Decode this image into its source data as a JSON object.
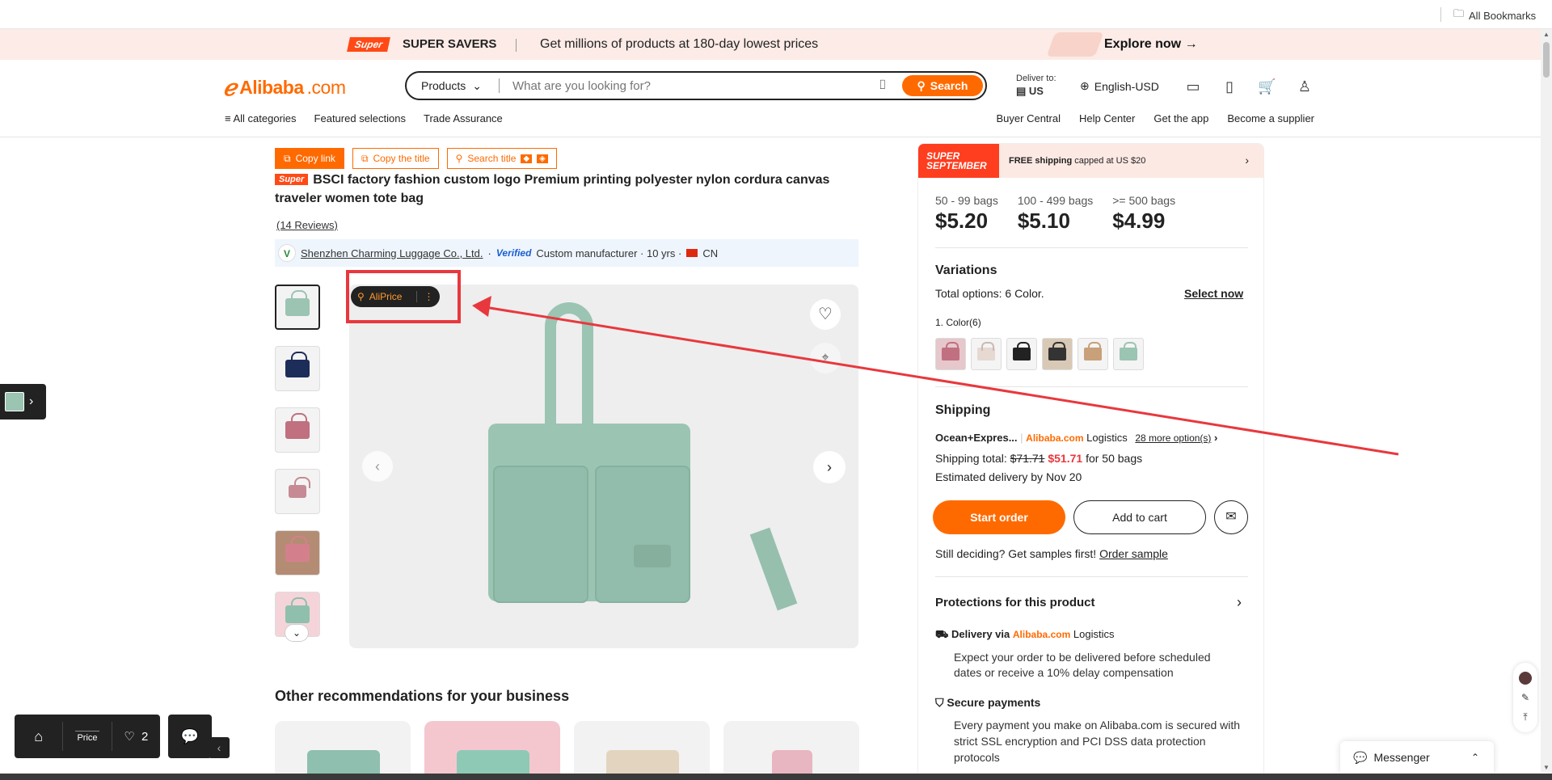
{
  "bookmarks": {
    "label": "All Bookmarks"
  },
  "promo": {
    "logo": "Super",
    "title": "SUPER SAVERS",
    "message": "Get millions of products at 180-day lowest prices",
    "cta": "Explore now →"
  },
  "header": {
    "brand_main": "Alibaba",
    "brand_suffix": ".com",
    "search_category": "Products",
    "search_placeholder": "What are you looking for?",
    "search_button": "Search",
    "deliver_label": "Deliver to:",
    "deliver_country": "US",
    "language": "English-USD",
    "nav_left": [
      "All categories",
      "Featured selections",
      "Trade Assurance"
    ],
    "nav_right": [
      "Buyer Central",
      "Help Center",
      "Get the app",
      "Become a supplier"
    ]
  },
  "tools": {
    "copy_link": "Copy link",
    "copy_title": "Copy the title",
    "search_title": "Search title"
  },
  "product": {
    "tag": "Super",
    "title": "BSCI factory fashion custom logo Premium printing polyester nylon cordura canvas traveler women tote bag",
    "reviews": "(14 Reviews)",
    "supplier_name": "Shenzhen Charming Luggage Co., Ltd.",
    "verified": "Verified",
    "supplier_meta": "Custom manufacturer · 10 yrs ·",
    "country": "CN"
  },
  "aliprice": {
    "label": "AliPrice"
  },
  "recommendations": {
    "title": "Other recommendations for your business"
  },
  "right_panel": {
    "banner_logo_line1": "SUPER",
    "banner_logo_line2": "SEPTEMBER",
    "banner_free": "FREE shipping",
    "banner_capped": "capped at US $20",
    "tiers": [
      {
        "qty": "50 - 99 bags",
        "price": "$5.20"
      },
      {
        "qty": "100 - 499 bags",
        "price": "$5.10"
      },
      {
        "qty": ">= 500 bags",
        "price": "$4.99"
      }
    ],
    "variations_title": "Variations",
    "total_options_label": "Total options:",
    "total_options_value": "6 Color.",
    "select_now": "Select now",
    "color_label": "1. Color(6)",
    "shipping_title": "Shipping",
    "shipping_method": "Ocean+Expres...",
    "logistics_brand": "Alibaba.com",
    "logistics_word": "Logistics",
    "more_options": "28 more option(s)",
    "shipping_total_label": "Shipping total:",
    "shipping_old": "$71.71",
    "shipping_new": "$51.71",
    "shipping_for": "for 50 bags",
    "estimated": "Estimated delivery by Nov 20",
    "start_order": "Start order",
    "add_to_cart": "Add to cart",
    "still_deciding": "Still deciding? Get samples first!",
    "order_sample": "Order sample",
    "protections_title": "Protections for this product",
    "delivery_via": "Delivery via",
    "delivery_desc": "Expect your order to be delivered before scheduled dates or receive a 10% delay compensation",
    "secure_title": "Secure payments",
    "secure_desc": "Every payment you make on Alibaba.com is secured with strict SSL encryption and PCI DSS data protection protocols"
  },
  "widgets": {
    "price_label": "Price",
    "favorites_count": "2",
    "messenger": "Messenger"
  },
  "colors": {
    "accent": "#ff6a00",
    "annotation": "#e8383d",
    "bag_green": "#9bc4b3"
  }
}
